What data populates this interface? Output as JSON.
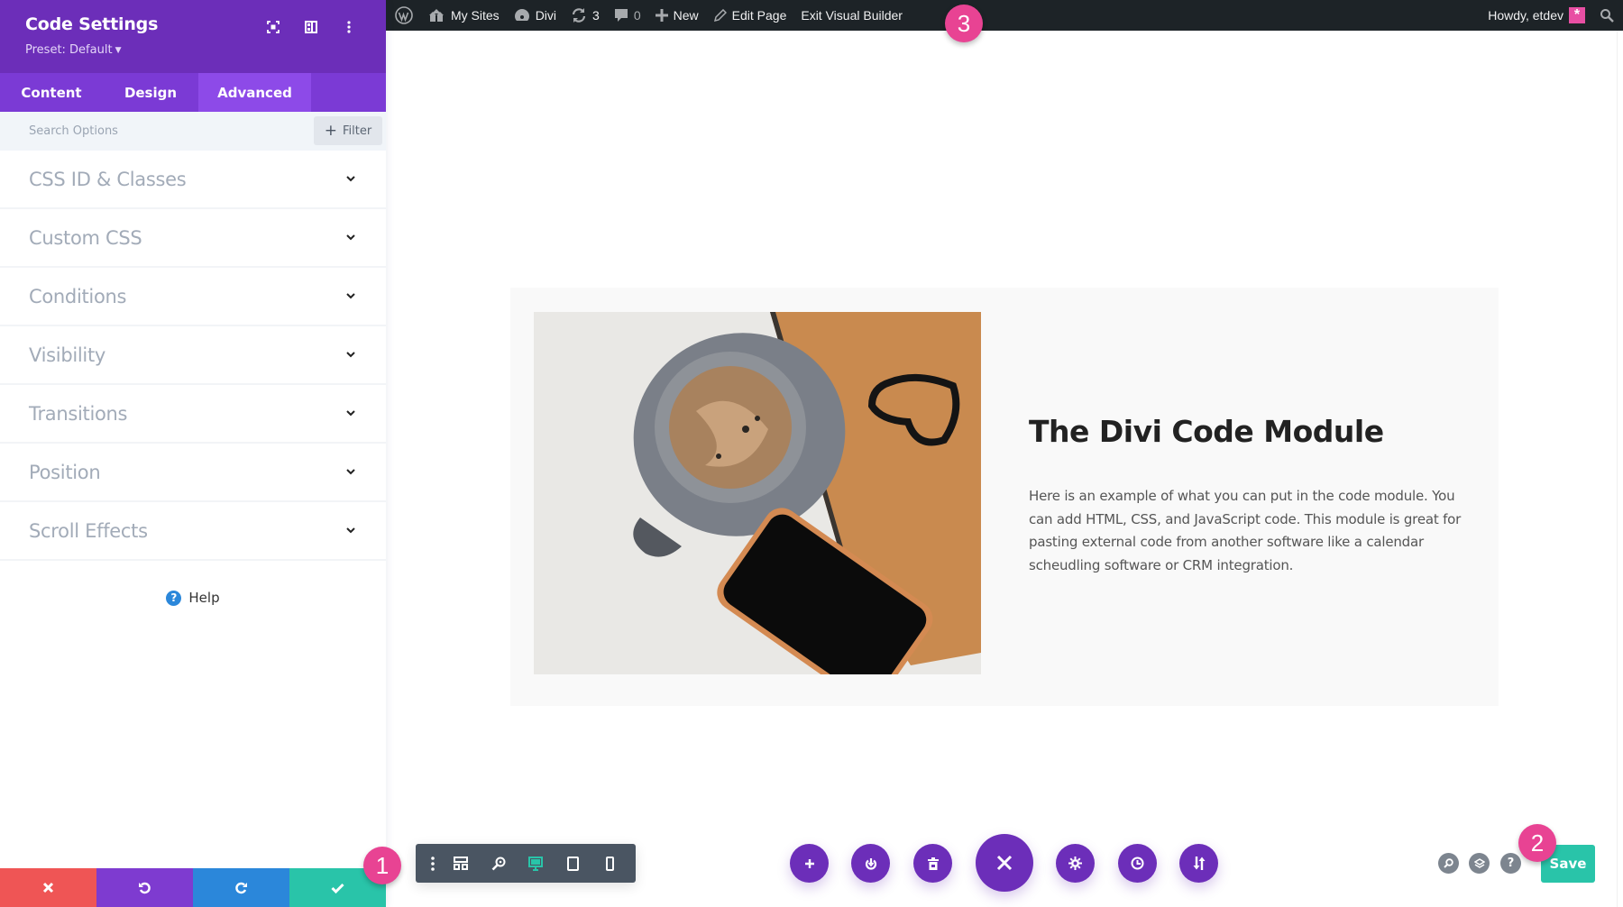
{
  "sidebar": {
    "title": "Code Settings",
    "preset_label": "Preset: Default",
    "header_icons": [
      "fullscreen-icon",
      "sidebar-layout-icon",
      "more-options-icon"
    ],
    "tabs": [
      {
        "label": "Content",
        "active": false
      },
      {
        "label": "Design",
        "active": false
      },
      {
        "label": "Advanced",
        "active": true
      }
    ],
    "search_placeholder": "Search Options",
    "filter_label": "Filter",
    "items": [
      {
        "label": "CSS ID & Classes"
      },
      {
        "label": "Custom CSS"
      },
      {
        "label": "Conditions"
      },
      {
        "label": "Visibility"
      },
      {
        "label": "Transitions"
      },
      {
        "label": "Position"
      },
      {
        "label": "Scroll Effects"
      }
    ],
    "help_label": "Help",
    "bottom_buttons": [
      "discard",
      "undo",
      "redo",
      "save-changes"
    ]
  },
  "adminbar": {
    "my_sites": "My Sites",
    "site_name": "Divi",
    "updates_count": "3",
    "comments_count": "0",
    "new_label": "New",
    "edit_page": "Edit Page",
    "exit_builder": "Exit Visual Builder",
    "greeting": "Howdy, etdev"
  },
  "content": {
    "title": "The Divi Code Module",
    "body": "Here is an example of what you can put in the code module. You can add HTML, CSS, and JavaScript code. This module is great for pasting external code from another software like a calendar scheudling software or CRM integration."
  },
  "responsive_toolbar": {
    "active_view": "desktop"
  },
  "builder_controls": [
    "add",
    "portability",
    "clear-layout",
    "close",
    "page-settings",
    "history",
    "import-export"
  ],
  "right_controls": {
    "save_label": "Save"
  },
  "annotations": [
    "1",
    "2",
    "3"
  ],
  "colors": {
    "purple": "#6c2eb9",
    "teal": "#29c4a9",
    "red": "#ef5555",
    "blue": "#2b87da",
    "badge_pink": "#e84393"
  }
}
